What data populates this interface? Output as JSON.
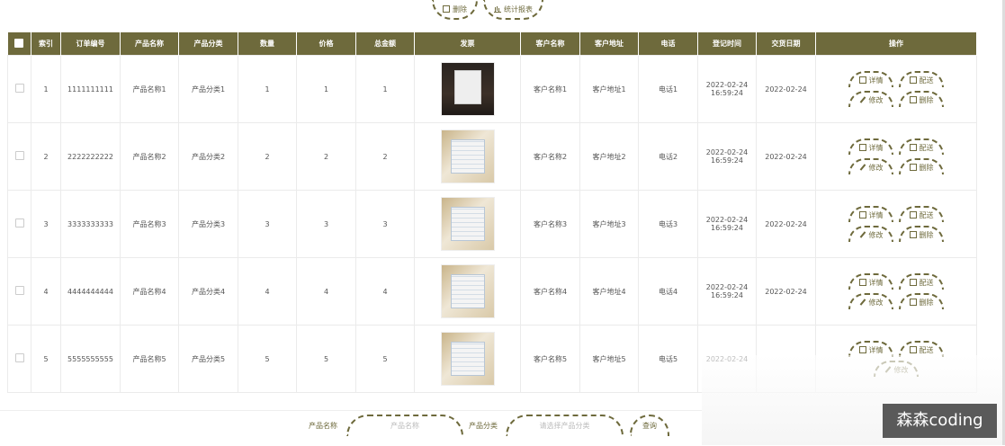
{
  "toolbar": {
    "delete_label": "删除",
    "report_label": "统计报表"
  },
  "table": {
    "headers": [
      "",
      "索引",
      "订单编号",
      "产品名称",
      "产品分类",
      "数量",
      "价格",
      "总金额",
      "发票",
      "客户名称",
      "客户地址",
      "电话",
      "登记时间",
      "交货日期",
      "操作"
    ],
    "rows": [
      {
        "index": "1",
        "order_no": "1111111111",
        "product": "产品名称1",
        "category": "产品分类1",
        "qty": "1",
        "price": "1",
        "total": "1",
        "customer": "客户名称1",
        "address": "客户地址1",
        "phone": "电话1",
        "reg_date": "2022-02-24",
        "reg_time": "16:59:24",
        "delivery": "2022-02-24"
      },
      {
        "index": "2",
        "order_no": "2222222222",
        "product": "产品名称2",
        "category": "产品分类2",
        "qty": "2",
        "price": "2",
        "total": "2",
        "customer": "客户名称2",
        "address": "客户地址2",
        "phone": "电话2",
        "reg_date": "2022-02-24",
        "reg_time": "16:59:24",
        "delivery": "2022-02-24"
      },
      {
        "index": "3",
        "order_no": "3333333333",
        "product": "产品名称3",
        "category": "产品分类3",
        "qty": "3",
        "price": "3",
        "total": "3",
        "customer": "客户名称3",
        "address": "客户地址3",
        "phone": "电话3",
        "reg_date": "2022-02-24",
        "reg_time": "16:59:24",
        "delivery": "2022-02-24"
      },
      {
        "index": "4",
        "order_no": "4444444444",
        "product": "产品名称4",
        "category": "产品分类4",
        "qty": "4",
        "price": "4",
        "total": "4",
        "customer": "客户名称4",
        "address": "客户地址4",
        "phone": "电话4",
        "reg_date": "2022-02-24",
        "reg_time": "16:59:24",
        "delivery": "2022-02-24"
      },
      {
        "index": "5",
        "order_no": "5555555555",
        "product": "产品名称5",
        "category": "产品分类5",
        "qty": "5",
        "price": "5",
        "total": "5",
        "customer": "客户名称5",
        "address": "客户地址5",
        "phone": "电话5",
        "reg_date": "2022-02-24",
        "reg_time": "",
        "delivery": ""
      }
    ],
    "actions": {
      "detail": "详情",
      "deliver": "配送",
      "edit": "修改",
      "delete": "删除"
    }
  },
  "search": {
    "product_label": "产品名称",
    "product_placeholder": "产品名称",
    "category_label": "产品分类",
    "category_placeholder": "请选择产品分类",
    "query_label": "查询"
  },
  "watermark": "森森coding",
  "colors": {
    "accent": "#6e6a3c"
  }
}
